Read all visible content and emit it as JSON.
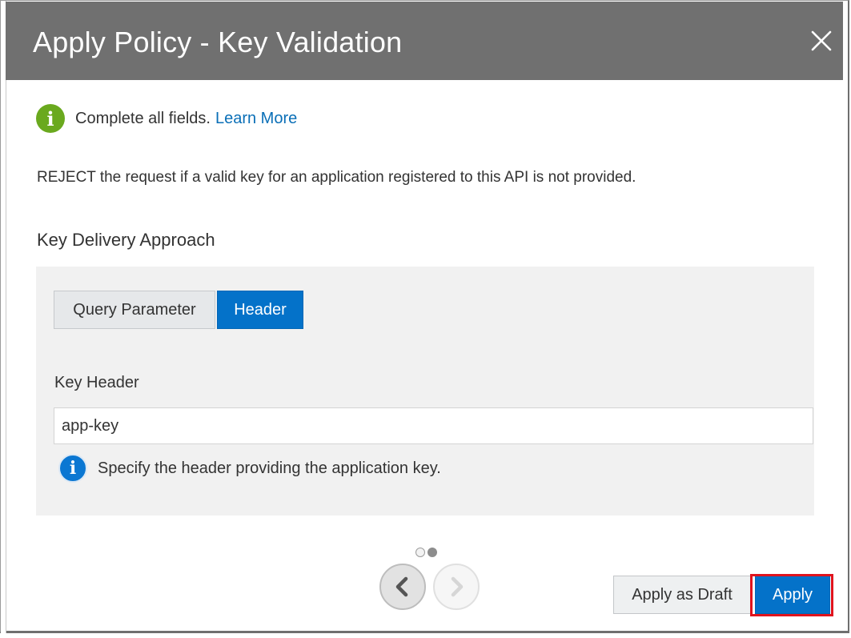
{
  "dialog": {
    "title": "Apply Policy - Key Validation",
    "close_icon": "close-icon"
  },
  "info": {
    "icon": "info-green-icon",
    "text": "Complete all fields.",
    "link": "Learn More"
  },
  "description": "REJECT the request if a valid key for an application registered to this API is not provided.",
  "section_title": "Key Delivery Approach",
  "toggle": {
    "options": [
      "Query Parameter",
      "Header"
    ],
    "selected": "Header"
  },
  "key_header": {
    "label": "Key Header",
    "value": "app-key",
    "hint": "Specify the header providing the application key.",
    "hint_icon": "info-blue-icon"
  },
  "pager": {
    "total": 2,
    "current": 2
  },
  "footer": {
    "apply_as_draft": "Apply as Draft",
    "apply": "Apply"
  },
  "colors": {
    "titlebar": "#707070",
    "primary": "#0472c9",
    "link": "#0a6fb7",
    "success": "#6aa91e",
    "highlight": "#e0141e"
  }
}
